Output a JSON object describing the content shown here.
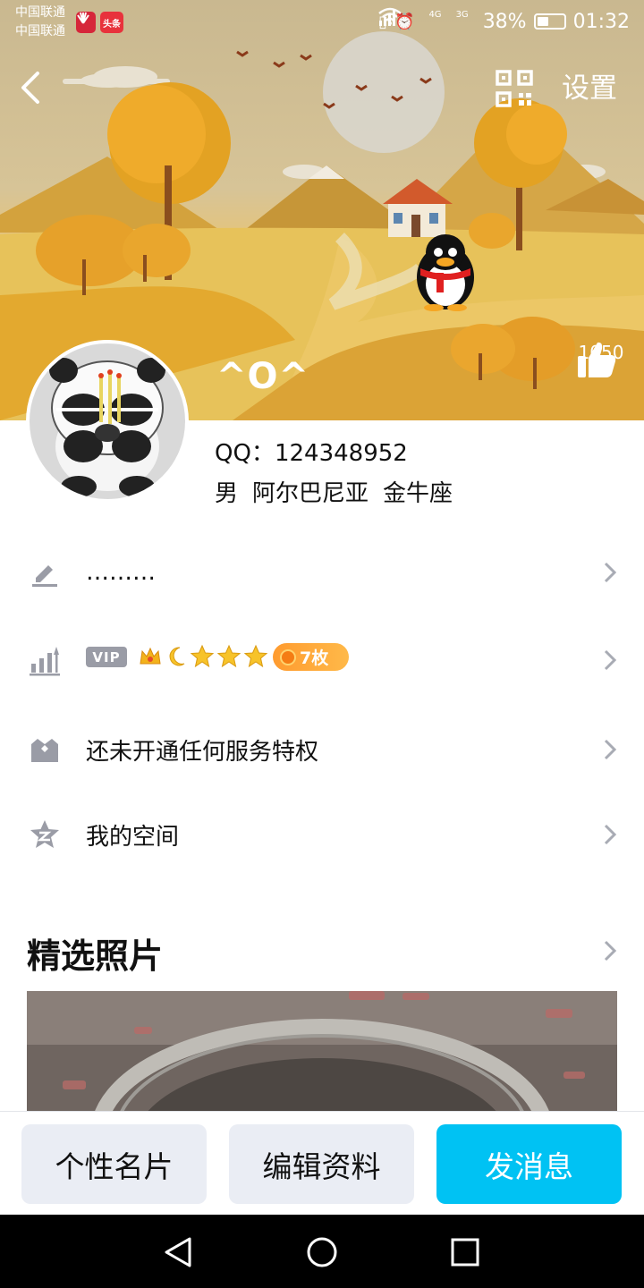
{
  "status_bar": {
    "carrier_1": "中国联通",
    "carrier_2": "中国联通",
    "badge_2": "头条",
    "net_1": "4G",
    "net_2": "3G",
    "battery": "38%",
    "time": "01:32"
  },
  "header": {
    "settings_label": "设置",
    "likes": "1050",
    "nickname": "^O^"
  },
  "profile": {
    "qq_label": "QQ：",
    "qq_number": "124348952",
    "gender": "男",
    "location": "阿尔巴尼亚",
    "zodiac": "金牛座"
  },
  "rows": {
    "signature": "………",
    "vip_tag": "VIP",
    "medal_count": "7枚",
    "privilege": "还未开通任何服务特权",
    "space": "我的空间"
  },
  "photos": {
    "title": "精选照片"
  },
  "actions": {
    "card": "个性名片",
    "edit": "编辑资料",
    "message": "发消息"
  },
  "colors": {
    "accent": "#00c2f3",
    "button_gray": "#eaedf4",
    "icon_gray": "#9a9ca6",
    "medal_orange": "#ffa13a"
  }
}
